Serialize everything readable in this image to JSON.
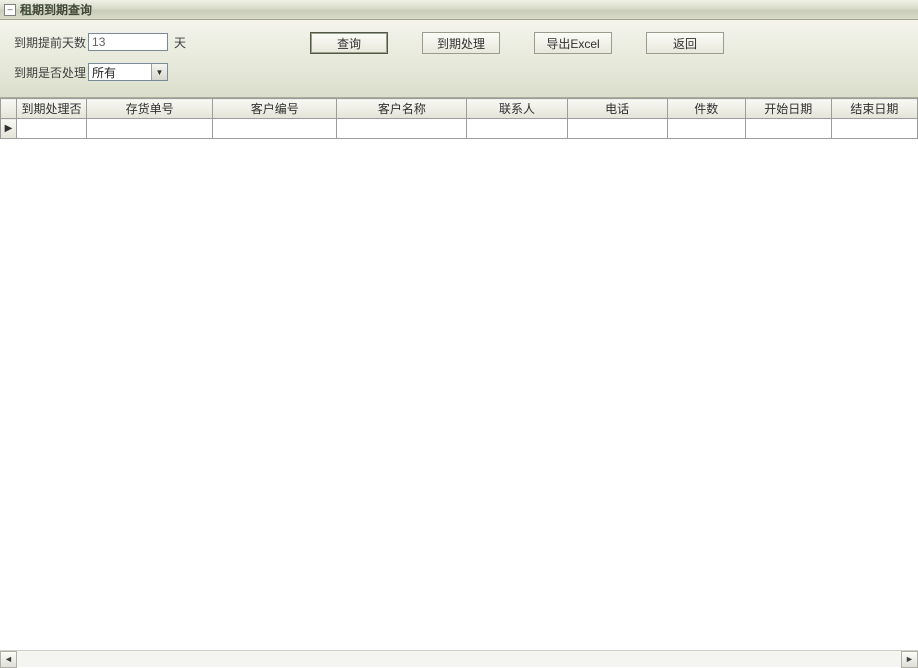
{
  "window": {
    "title": "租期到期查询"
  },
  "filters": {
    "days_label": "到期提前天数",
    "days_value": "13",
    "days_unit": "天",
    "processed_label": "到期是否处理",
    "processed_value": "所有"
  },
  "buttons": {
    "query": "查询",
    "process": "到期处理",
    "export": "导出Excel",
    "back": "返回"
  },
  "table": {
    "columns": [
      "到期处理否",
      "存货单号",
      "客户编号",
      "客户名称",
      "联系人",
      "电话",
      "件数",
      "开始日期",
      "结束日期"
    ],
    "rows": [
      {
        "cells": [
          "",
          "",
          "",
          "",
          "",
          "",
          "",
          "",
          ""
        ]
      }
    ]
  }
}
